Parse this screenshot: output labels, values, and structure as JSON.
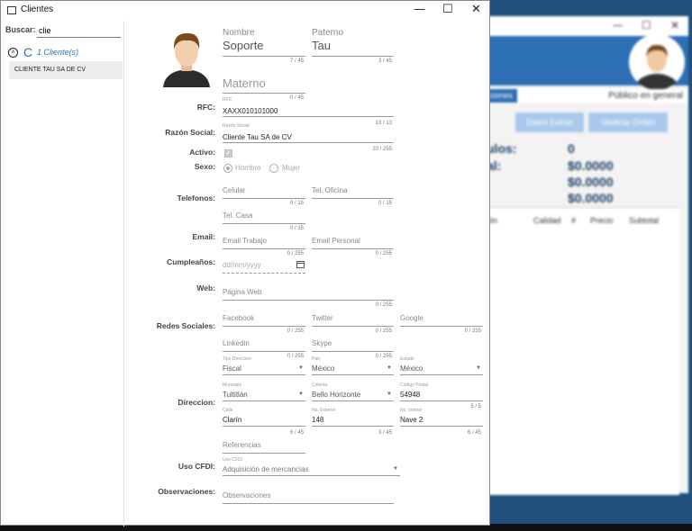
{
  "window": {
    "title": "Clientes",
    "controls": {
      "min": "—",
      "max": "☐",
      "close": "✕"
    }
  },
  "search": {
    "label": "Buscar:",
    "value": "clie"
  },
  "group": {
    "collapse": "˄",
    "letter": "C",
    "count": "1 Cliente(s)"
  },
  "clients": [
    "CLIENTE TAU SA DE CV"
  ],
  "form": {
    "nombre": {
      "placeholder": "Nombre",
      "value": "Soporte",
      "count": "7 / 45"
    },
    "paterno": {
      "placeholder": "Paterno",
      "value": "Tau",
      "count": "3 / 45"
    },
    "materno": {
      "placeholder": "Materno",
      "count": "0 / 45"
    },
    "rfc": {
      "label": "RFC:",
      "caption": "RFC",
      "value": "XAXX010101000",
      "count": "13 / 13"
    },
    "razon": {
      "label": "Razón Social:",
      "caption": "Razón Social",
      "value": "Cliente Tau SA de CV",
      "count": "20 / 255"
    },
    "activo": {
      "label": "Activo:",
      "checked": true
    },
    "sexo": {
      "label": "Sexo:",
      "options": [
        "Hombre",
        "Mujer"
      ]
    },
    "telefonos": {
      "label": "Telefonos:",
      "celular": "Celular",
      "celular_count": "0 / 15",
      "oficina": "Tel. Oficina",
      "oficina_count": "0 / 15",
      "casa": "Tel. Casa",
      "casa_count": "0 / 15"
    },
    "email": {
      "label": "Email:",
      "trabajo": "Email Trabajo",
      "trabajo_count": "0 / 255",
      "personal": "Email Personal",
      "personal_count": "0 / 255"
    },
    "cumple": {
      "label": "Cumpleaños:",
      "placeholder": "dd/mm/yyyy"
    },
    "web": {
      "label": "Web:",
      "placeholder": "Página Web",
      "count": "0 / 255"
    },
    "redes": {
      "label": "Redes Sociales:",
      "facebook": "Facebook",
      "facebook_count": "0 / 255",
      "twitter": "Twitter",
      "twitter_count": "0 / 255",
      "google": "Google",
      "google_count": "0 / 255",
      "linkedin": "Linkedin",
      "linkedin_count": "0 / 255",
      "skype": "Skype",
      "skype_count": "0 / 255"
    },
    "direccion": {
      "label": "Direccion:",
      "tipo_caption": "Tipo Direccion",
      "tipo": "Fiscal",
      "pais_caption": "Pais",
      "pais": "México",
      "estado_caption": "Estado",
      "estado": "México",
      "municipio_caption": "Municipio",
      "municipio": "Tultitlán",
      "colonia_caption": "Colonia",
      "colonia": "Bello Horizonte",
      "cp_caption": "Código Postal",
      "cp": "54948",
      "cp_count": "5 / 5",
      "calle_caption": "Calle",
      "calle": "Clarín",
      "calle_count": "6 / 45",
      "ext_caption": "No. Exterior",
      "ext": "148",
      "ext_count": "3 / 45",
      "int_caption": "No. Interior",
      "int": "Nave 2",
      "int_count": "6 / 45",
      "referencias": "Referencias"
    },
    "cfdi": {
      "label": "Uso CFDI:",
      "caption": "Uso CFDI",
      "value": "Adquisición de mercancías"
    },
    "obs": {
      "label": "Observaciones:",
      "placeholder": "Observaciones"
    }
  },
  "background": {
    "tab": "ciones",
    "publico": "Público en general",
    "btn1": "Datos Extras",
    "btn2": "Verificar Orden",
    "l1": "ulos:",
    "v1": "0",
    "l2": "al:",
    "v2": "$0.0000",
    "v3": "$0.0000",
    "v4": "$0.0000",
    "th": [
      "ón",
      "Calidad",
      "#",
      "Precio",
      "Subtotal"
    ],
    "controls": {
      "min": "—",
      "max": "☐",
      "close": "✕"
    }
  },
  "colors": {
    "accent": "#2d6fb3",
    "window_bg": "#ffffff",
    "desktop": "#1f4f7a"
  }
}
